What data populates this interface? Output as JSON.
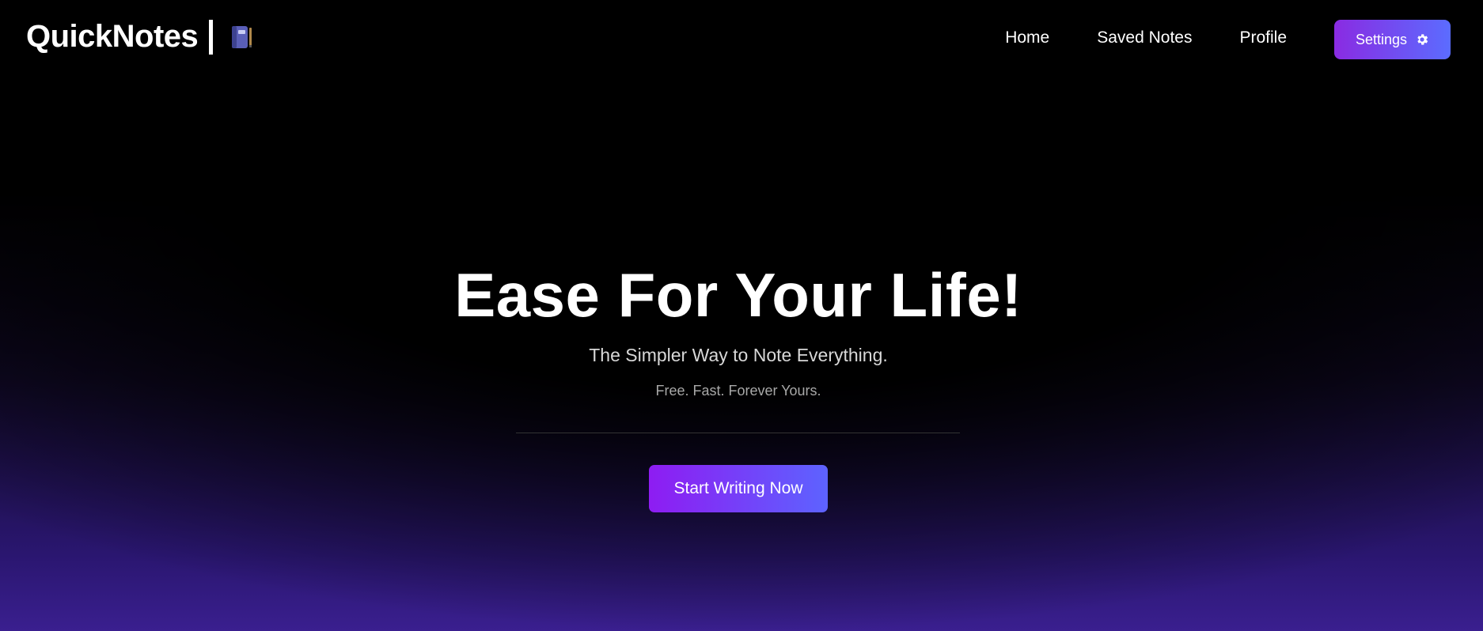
{
  "brand": {
    "name": "QuickNotes",
    "icon": "notebook-icon"
  },
  "nav": {
    "links": [
      "Home",
      "Saved Notes",
      "Profile"
    ],
    "settings_label": "Settings",
    "settings_icon": "gear-icon"
  },
  "hero": {
    "title": "Ease For Your Life!",
    "subtitle": "The Simpler Way to Note Everything.",
    "tagline": "Free. Fast. Forever Yours.",
    "cta_label": "Start Writing Now"
  },
  "colors": {
    "accent_start": "#8a2be2",
    "accent_end": "#5b6cff",
    "background": "#000000",
    "glow": "#3a1f8f"
  }
}
